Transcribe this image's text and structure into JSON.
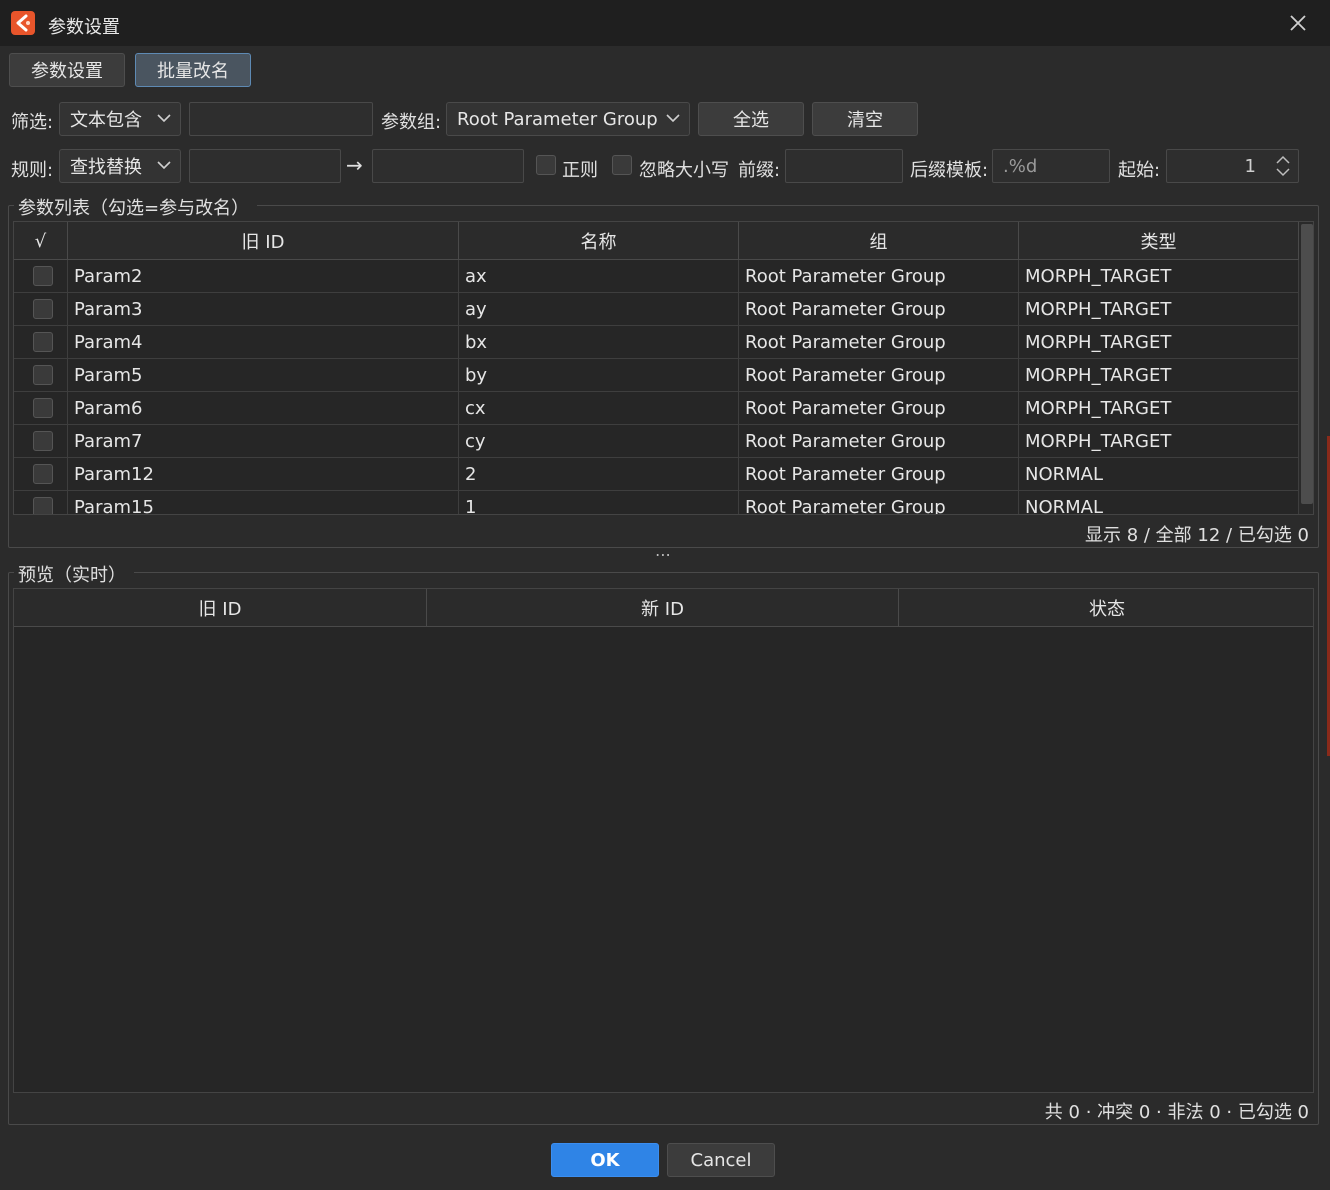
{
  "window": {
    "title": "参数设置"
  },
  "tabs": [
    {
      "label": "参数设置"
    },
    {
      "label": "批量改名"
    }
  ],
  "filter": {
    "label": "筛选:",
    "mode": "文本包含",
    "text_value": "",
    "group_label": "参数组:",
    "group_value": "Root Parameter Group",
    "select_all": "全选",
    "clear": "清空"
  },
  "rule": {
    "label": "规则:",
    "mode": "查找替换",
    "find_value": "",
    "arrow": "→",
    "replace_value": "",
    "regex_label": "正则",
    "ignore_case_label": "忽略大小写",
    "prefix_label": "前缀:",
    "prefix_value": "",
    "suffix_label": "后缀模板:",
    "suffix_placeholder": ".%d",
    "start_label": "起始:",
    "start_value": "1"
  },
  "param_list": {
    "title": "参数列表（勾选=参与改名）",
    "columns": {
      "check": "√",
      "old_id": "旧 ID",
      "name": "名称",
      "group": "组",
      "type": "类型"
    },
    "rows": [
      {
        "id": "Param2",
        "name": "ax",
        "group": "Root Parameter Group",
        "type": "MORPH_TARGET",
        "checked": false
      },
      {
        "id": "Param3",
        "name": "ay",
        "group": "Root Parameter Group",
        "type": "MORPH_TARGET",
        "checked": false
      },
      {
        "id": "Param4",
        "name": "bx",
        "group": "Root Parameter Group",
        "type": "MORPH_TARGET",
        "checked": false
      },
      {
        "id": "Param5",
        "name": "by",
        "group": "Root Parameter Group",
        "type": "MORPH_TARGET",
        "checked": false
      },
      {
        "id": "Param6",
        "name": "cx",
        "group": "Root Parameter Group",
        "type": "MORPH_TARGET",
        "checked": false
      },
      {
        "id": "Param7",
        "name": "cy",
        "group": "Root Parameter Group",
        "type": "MORPH_TARGET",
        "checked": false
      },
      {
        "id": "Param12",
        "name": "2",
        "group": "Root Parameter Group",
        "type": "NORMAL",
        "checked": false
      },
      {
        "id": "Param15",
        "name": "1",
        "group": "Root Parameter Group",
        "type": "NORMAL",
        "checked": false
      }
    ],
    "status": "显示 8 / 全部 12 / 已勾选 0"
  },
  "splitter": "⋯",
  "preview": {
    "title": "预览（实时）",
    "columns": {
      "old_id": "旧 ID",
      "new_id": "新 ID",
      "status": "状态"
    },
    "status": "共 0 · 冲突 0 · 非法 0 · 已勾选 0"
  },
  "footer": {
    "ok": "OK",
    "cancel": "Cancel"
  },
  "colors": {
    "accent": "#2f84e6",
    "background": "#2b2b2b",
    "titlebar": "#1f1f1f",
    "app_icon": "#e8552b"
  }
}
